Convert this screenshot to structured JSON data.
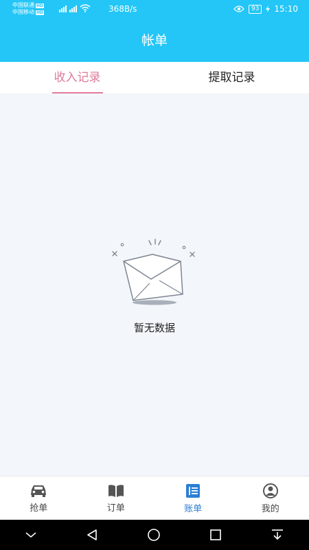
{
  "status_bar": {
    "carrier1": "中国联通",
    "carrier2": "中国移动",
    "hd": "HD",
    "net_speed": "368B/s",
    "battery": "93",
    "time": "15:10"
  },
  "header": {
    "title": "帐单"
  },
  "tabs": [
    {
      "label": "收入记录",
      "active": true
    },
    {
      "label": "提取记录",
      "active": false
    }
  ],
  "empty_state": {
    "text": "暂无数据"
  },
  "bottom_nav": {
    "items": [
      {
        "label": "抢单",
        "icon": "car-icon"
      },
      {
        "label": "订单",
        "icon": "book-icon"
      },
      {
        "label": "账单",
        "icon": "bill-icon",
        "active": true
      },
      {
        "label": "我的",
        "icon": "user-icon"
      }
    ]
  },
  "colors": {
    "primary": "#23c6f7",
    "tab_active": "#e07a9a",
    "nav_active": "#2a7fd4"
  }
}
